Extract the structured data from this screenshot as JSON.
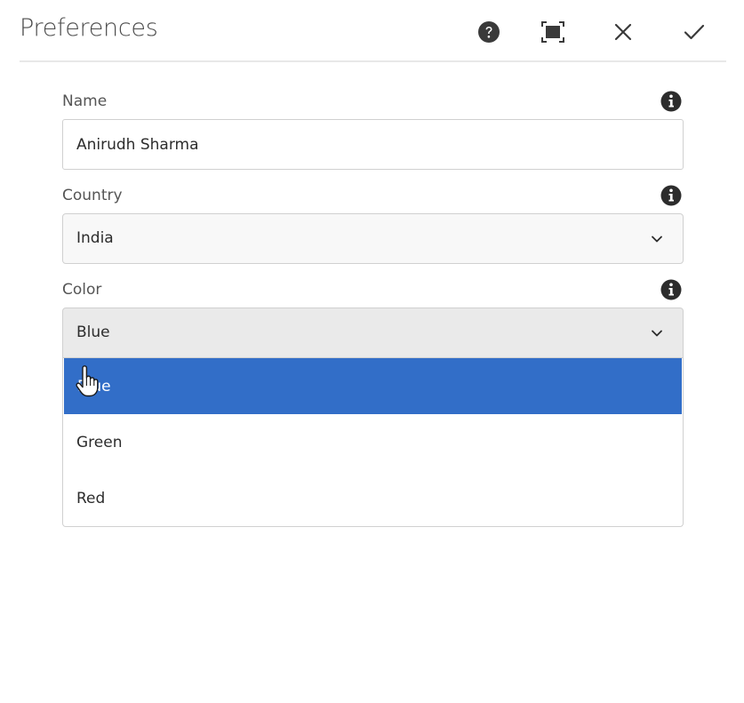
{
  "dialog": {
    "title": "Preferences",
    "actions": {
      "help_icon": "help-icon",
      "fullscreen_icon": "fullscreen-icon",
      "close_icon": "close-icon",
      "confirm_icon": "checkmark-icon"
    }
  },
  "fields": {
    "name": {
      "label": "Name",
      "value": "Anirudh Sharma",
      "info_icon": "info-icon"
    },
    "country": {
      "label": "Country",
      "value": "India",
      "info_icon": "info-icon"
    },
    "color": {
      "label": "Color",
      "value": "Blue",
      "info_icon": "info-icon",
      "expanded": true,
      "options": [
        "Blue",
        "Green",
        "Red"
      ],
      "selected_option": "Blue"
    }
  },
  "colors": {
    "selected_option_bg": "#326ec8",
    "header_text": "#4b4b4b",
    "icon_color": "#3a3a3a"
  }
}
